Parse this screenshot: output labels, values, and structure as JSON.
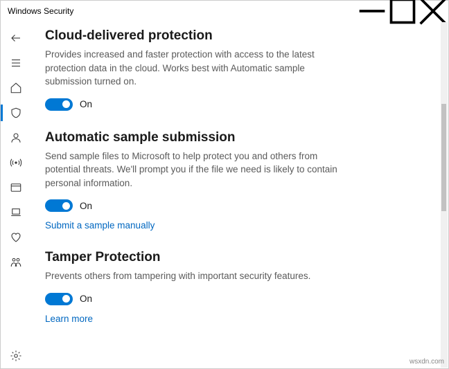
{
  "window": {
    "title": "Windows Security"
  },
  "sections": {
    "cloud": {
      "title": "Cloud-delivered protection",
      "desc": "Provides increased and faster protection with access to the latest protection data in the cloud. Works best with Automatic sample submission turned on.",
      "toggle_state": "On"
    },
    "sample": {
      "title": "Automatic sample submission",
      "desc": "Send sample files to Microsoft to help protect you and others from potential threats. We'll prompt you if the file we need is likely to contain personal information.",
      "toggle_state": "On",
      "link": "Submit a sample manually"
    },
    "tamper": {
      "title": "Tamper Protection",
      "desc": "Prevents others from tampering with important security features.",
      "toggle_state": "On",
      "link": "Learn more"
    }
  },
  "watermark": "wsxdn.com"
}
